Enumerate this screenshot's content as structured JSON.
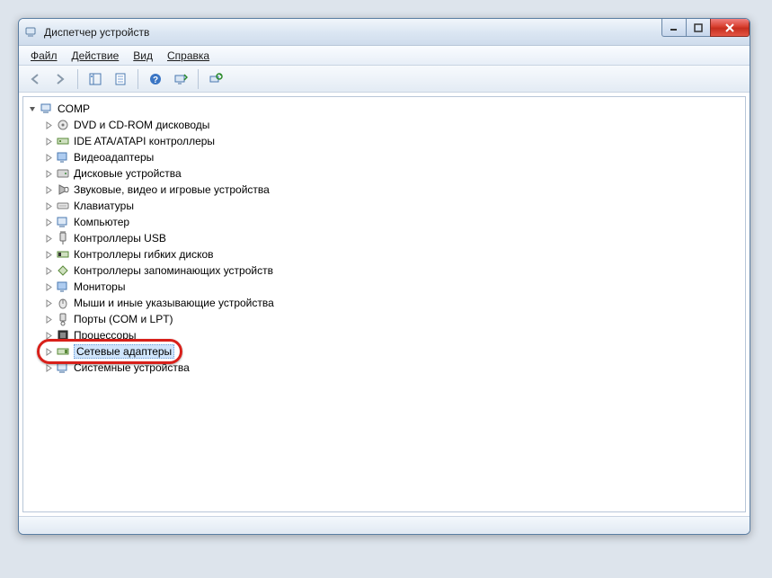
{
  "window": {
    "title": "Диспетчер устройств"
  },
  "menu": {
    "file": "Файл",
    "action": "Действие",
    "view": "Вид",
    "help": "Справка"
  },
  "tree": {
    "root": "COMP",
    "items": [
      {
        "label": "DVD и CD-ROM дисководы"
      },
      {
        "label": "IDE ATA/ATAPI контроллеры"
      },
      {
        "label": "Видеоадаптеры"
      },
      {
        "label": "Дисковые устройства"
      },
      {
        "label": "Звуковые, видео и игровые устройства"
      },
      {
        "label": "Клавиатуры"
      },
      {
        "label": "Компьютер"
      },
      {
        "label": "Контроллеры USB"
      },
      {
        "label": "Контроллеры гибких дисков"
      },
      {
        "label": "Контроллеры запоминающих устройств"
      },
      {
        "label": "Мониторы"
      },
      {
        "label": "Мыши и иные указывающие устройства"
      },
      {
        "label": "Порты (COM и LPT)"
      },
      {
        "label": "Процессоры"
      },
      {
        "label": "Сетевые адаптеры",
        "selected": true,
        "highlighted": true
      },
      {
        "label": "Системные устройства"
      }
    ]
  }
}
